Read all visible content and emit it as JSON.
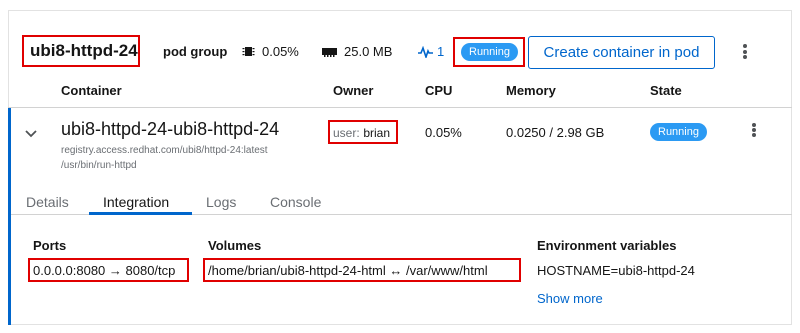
{
  "pod": {
    "name": "ubi8-httpd-24",
    "group_label": "pod group",
    "cpu": "0.05%",
    "memory": "25.0 MB",
    "activity_count": "1",
    "status": "Running",
    "create_button": "Create container in pod"
  },
  "table": {
    "headers": [
      "Container",
      "Owner",
      "CPU",
      "Memory",
      "State"
    ]
  },
  "container": {
    "name": "ubi8-httpd-24-ubi8-httpd-24",
    "image": "registry.access.redhat.com/ubi8/httpd-24:latest",
    "command": "/usr/bin/run-httpd",
    "owner_prefix": "user:",
    "owner": "brian",
    "cpu": "0.05%",
    "memory": "0.0250 / 2.98 GB",
    "state": "Running"
  },
  "tabs": [
    "Details",
    "Integration",
    "Logs",
    "Console"
  ],
  "active_tab": "Integration",
  "integration": {
    "ports_label": "Ports",
    "ports_value": "0.0.0.0:8080 → 8080/tcp",
    "volumes_label": "Volumes",
    "volumes_value": "/home/brian/ubi8-httpd-24-html ↔ /var/www/html",
    "env_label": "Environment variables",
    "env_value": "HOSTNAME=ubi8-httpd-24",
    "show_more": "Show more"
  },
  "colors": {
    "accent": "#0066cc",
    "badge": "#2b9af3",
    "highlight": "#e00000"
  },
  "icons": [
    "chip-icon",
    "memory-icon",
    "activity-icon",
    "chevron-down-icon",
    "kebab-icon"
  ]
}
